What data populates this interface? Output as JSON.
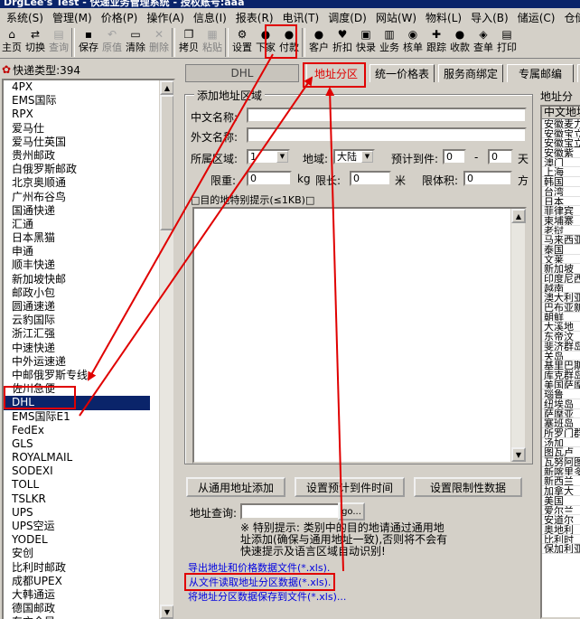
{
  "window": {
    "title": "DrgLee's Test - 快递业务管理系统 - 授权账号:aaa"
  },
  "menu": [
    "系统(S)",
    "管理(M)",
    "价格(P)",
    "操作(A)",
    "信息(I)",
    "报表(R)",
    "电讯(T)",
    "调度(D)",
    "网站(W)",
    "物料(L)",
    "导入(B)",
    "储运(C)",
    "仓储(W)"
  ],
  "toolbar": [
    {
      "label": "主页",
      "icon": "home-icon",
      "glyph": "⌂",
      "enabled": true
    },
    {
      "label": "切换",
      "icon": "switch-icon",
      "glyph": "⇄",
      "enabled": true
    },
    {
      "label": "查询",
      "icon": "query-icon",
      "glyph": "▤",
      "enabled": false
    },
    {
      "sep": true
    },
    {
      "label": "保存",
      "icon": "save-icon",
      "glyph": "▪",
      "enabled": true
    },
    {
      "label": "原值",
      "icon": "restore-icon",
      "glyph": "↶",
      "enabled": false
    },
    {
      "label": "清除",
      "icon": "clear-icon",
      "glyph": "▭",
      "enabled": true
    },
    {
      "label": "删除",
      "icon": "delete-icon",
      "glyph": "✕",
      "enabled": false
    },
    {
      "sep": true
    },
    {
      "label": "拷贝",
      "icon": "copy-icon",
      "glyph": "❐",
      "enabled": true
    },
    {
      "label": "粘贴",
      "icon": "paste-icon",
      "glyph": "▦",
      "enabled": false
    },
    {
      "sep": true
    },
    {
      "label": "设置",
      "icon": "settings-icon",
      "glyph": "⚙",
      "enabled": true,
      "highlight": true
    },
    {
      "label": "下家",
      "icon": "downstream-icon",
      "glyph": "●",
      "enabled": true
    },
    {
      "label": "付款",
      "icon": "payment-icon",
      "glyph": "●",
      "enabled": true
    },
    {
      "sep": true
    },
    {
      "label": "客户",
      "icon": "customer-icon",
      "glyph": "●",
      "enabled": true
    },
    {
      "label": "折扣",
      "icon": "discount-icon",
      "glyph": "♥",
      "enabled": true
    },
    {
      "label": "快录",
      "icon": "quick-entry-icon",
      "glyph": "▣",
      "enabled": true
    },
    {
      "label": "业务",
      "icon": "business-icon",
      "glyph": "▥",
      "enabled": true
    },
    {
      "label": "核单",
      "icon": "verify-icon",
      "glyph": "◉",
      "enabled": true
    },
    {
      "label": "跟踪",
      "icon": "track-icon",
      "glyph": "✚",
      "enabled": true
    },
    {
      "label": "收款",
      "icon": "receipt-icon",
      "glyph": "●",
      "enabled": true
    },
    {
      "label": "查单",
      "icon": "search-order-icon",
      "glyph": "◈",
      "enabled": true
    },
    {
      "label": "打印",
      "icon": "print-icon",
      "glyph": "▤",
      "enabled": true
    }
  ],
  "leftpane": {
    "header": "快递类型:394",
    "items": [
      "4PX",
      "EMS国际",
      "RPX",
      "爱马仕",
      "爱马仕英国",
      "贵州邮政",
      "白俄罗斯邮政",
      "北京奥顺通",
      "广州布谷鸟",
      "国通快递",
      "汇通",
      "日本黑猫",
      "申通",
      "顺丰快递",
      "新加坡快邮",
      "邮政小包",
      "圆通速递",
      "云豹国际",
      "浙江汇强",
      "中速快递",
      "中外运速递",
      "中邮俄罗斯专线",
      "佐川急便",
      "DHL",
      "EMS国际E1",
      "FedEx",
      "GLS",
      "ROYALMAIL",
      "SODEXI",
      "TOLL",
      "TSLKR",
      "UPS",
      "UPS空运",
      "YODEL",
      "安创",
      "比利时邮政",
      "成都UPEX",
      "大韩通运",
      "德国邮政",
      "东方全局"
    ],
    "selected_index": 23
  },
  "tabs": [
    {
      "label": "DHL",
      "sunken": true
    },
    {
      "label": "地址分区",
      "active": true,
      "highlight": true
    },
    {
      "label": "统一价格表"
    },
    {
      "label": "服务商绑定"
    },
    {
      "label": "专属邮编"
    },
    {
      "label": "同"
    }
  ],
  "form": {
    "group_title": "添加地址区域",
    "cn_name_label": "中文名称:",
    "en_name_label": "外文名称:",
    "zone_label": "所属区域:",
    "zone_value": "1",
    "region_label": "地域:",
    "region_value": "大陆",
    "eta_label": "预计到件:",
    "eta_from": "0",
    "eta_dash": "-",
    "eta_to": "0",
    "eta_unit": "天",
    "weight_limit_label": "限重:",
    "weight_limit_value": "0",
    "weight_unit": "kg",
    "length_limit_label": "限长:",
    "length_limit_value": "0",
    "length_unit": "米",
    "volume_limit_label": "限体积:",
    "volume_limit_value": "0",
    "volume_unit": "方",
    "memo_label": "□目的地特别提示(≤1KB)□",
    "btn_add_general": "从通用地址添加",
    "btn_set_eta": "设置预计到件时间",
    "btn_set_limits": "设置限制性数据",
    "query_label": "地址查询:",
    "query_button": "go...",
    "hint": "※ 特别提示: 类别中的目的地请通过通用地址添加(确保与通用地址一致),否则将不会有快速提示及语言区域自动识别!",
    "link_export": "导出地址和价格数据文件(*.xls).",
    "link_import": "从文件读取地址分区数据(*.xls).",
    "link_save": "将地址分区数据保存到文件(*.xls)..."
  },
  "rightpanel": {
    "title": "地址分",
    "header": "中文地址",
    "rows": [
      "安徽麦力",
      "安徽宝立",
      "安徽宝立",
      "安徽紫",
      "澳门",
      "上海",
      "韩国",
      "台湾",
      "日本",
      "菲律宾",
      "柬埔寨",
      "老挝",
      "马来西亚",
      "泰国",
      "文莱",
      "新加坡",
      "印度尼西",
      "越南",
      "澳大利亚",
      "巴布亚新",
      "朝鲜",
      "大溪地",
      "东帝汶",
      "斐济群岛",
      "关岛",
      "基里巴斯",
      "库克群岛",
      "美国萨摩",
      "瑙鲁",
      "纽埃岛",
      "萨摩亚",
      "塞班岛",
      "所罗门群",
      "汤加",
      "图瓦卢",
      "瓦努阿图",
      "新喀里多",
      "新西兰",
      "加拿大",
      "美国",
      "爱尔兰",
      "安道尔",
      "奥地利",
      "比利时",
      "保加利亚"
    ]
  },
  "colors": {
    "highlight": "#e00000",
    "selection": "#0a246a",
    "link": "#0000e0",
    "face": "#d4d0c8"
  }
}
